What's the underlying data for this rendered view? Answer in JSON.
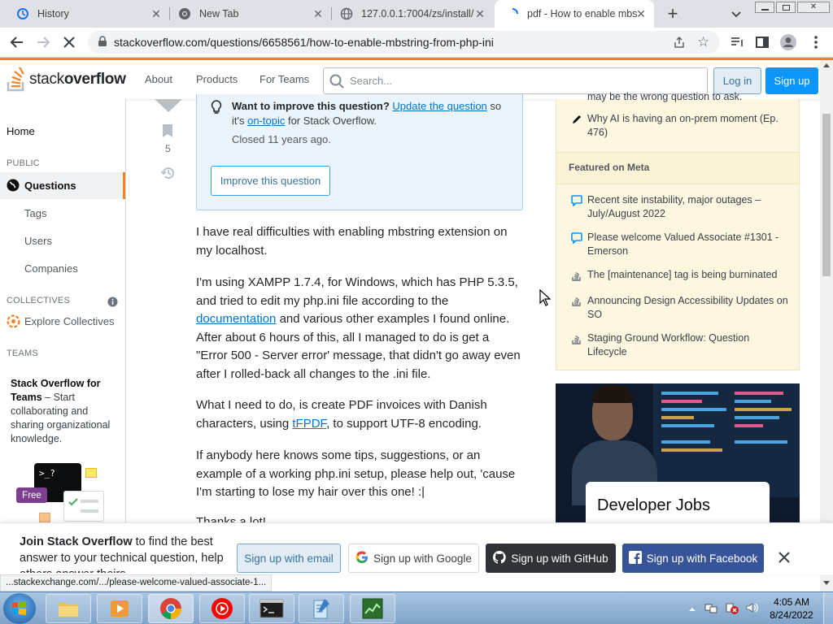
{
  "browser": {
    "tabs": [
      {
        "title": "History",
        "icon": "history-icon"
      },
      {
        "title": "New Tab",
        "icon": "chrome-icon"
      },
      {
        "title": "127.0.0.1:7004/zs/install/",
        "icon": "globe-icon"
      },
      {
        "title": "pdf - How to enable mbs",
        "icon": "loading-icon"
      }
    ],
    "url": "stackoverflow.com/questions/6658561/how-to-enable-mbstring-from-php-ini",
    "status_url": "...stackexchange.com/.../please-welcome-valued-associate-1..."
  },
  "header": {
    "logo_text_1": "stack",
    "logo_text_2": "overflow",
    "nav": [
      "About",
      "Products",
      "For Teams"
    ],
    "search_placeholder": "Search...",
    "login": "Log in",
    "signup": "Sign up"
  },
  "leftnav": {
    "home": "Home",
    "public_head": "PUBLIC",
    "questions": "Questions",
    "tags": "Tags",
    "users": "Users",
    "companies": "Companies",
    "collectives_head": "COLLECTIVES",
    "explore_collectives": "Explore Collectives",
    "teams_head": "TEAMS",
    "teams_title": "Stack Overflow for Teams",
    "teams_dash": " – Start collaborating and sharing organizational knowledge.",
    "free_badge": "Free",
    "teams_prompt": ">_?"
  },
  "vote": {
    "count": "5"
  },
  "notice": {
    "bold": "Want to improve this question?",
    "link": "Update the question",
    "text1": " so",
    "text2": "it's ",
    "ontopic": "on-topic",
    "text3": " for Stack Overflow.",
    "closed": "Closed 11 years ago.",
    "improve_button": "Improve this question"
  },
  "post": {
    "p1": "I have real difficulties with enabling mbstring extension on my localhost.",
    "p2_a": "I'm using XAMPP 1.7.4, for Windows, which has PHP 5.3.5, and tried to edit my php.ini file according to the",
    "p2_link": "documentation",
    "p2_b": " and various other examples I found online. After about 6 hours of this, all I managed to do is get a \"Error 500 - Server error' message, that didn't go away even after I rolled-back all changes to the .ini file.",
    "p3_a": "What I need to do, is create PDF invoices with Danish characters, using ",
    "p3_link": "tFPDF",
    "p3_b": ", to support UTF-8 encoding.",
    "p4": "If anybody here knows some tips, suggestions, or an example of a working php.ini setup, please help out, 'cause I'm starting to lose my hair over this one! :|",
    "p5": "Thanks a lot!"
  },
  "sidebar": {
    "partial_item": "may be the wrong question to ask.",
    "blog_item": "Why AI is having an on-prem moment (Ep. 476)",
    "meta_head": "Featured on Meta",
    "meta_items": [
      {
        "text": "Recent site instability, major outages – July/August 2022",
        "icon": "chat-icon"
      },
      {
        "text": "Please welcome Valued Associate #1301 - Emerson",
        "icon": "chat-icon"
      },
      {
        "text": "The [maintenance] tag is being burninated",
        "icon": "stack-icon"
      },
      {
        "text": "Announcing Design Accessibility Updates on SO",
        "icon": "stack-icon"
      },
      {
        "text": "Staging Ground Workflow: Question Lifecycle",
        "icon": "stack-icon"
      }
    ],
    "ad_title": "Developer Jobs"
  },
  "joinbar": {
    "bold": "Join Stack Overflow",
    "text": " to find the best answer to your technical question, help others answer theirs.",
    "email": "Sign up with email",
    "google": "Sign up with Google",
    "github": "Sign up with GitHub",
    "facebook": "Sign up with Facebook"
  },
  "taskbar": {
    "time": "4:05 AM",
    "date": "8/24/2022"
  },
  "colors": {
    "so_orange": "#f48225",
    "so_blue": "#0a95ff",
    "notice_bg": "#ebf4fb",
    "meta_bg": "#fdf7e2"
  }
}
